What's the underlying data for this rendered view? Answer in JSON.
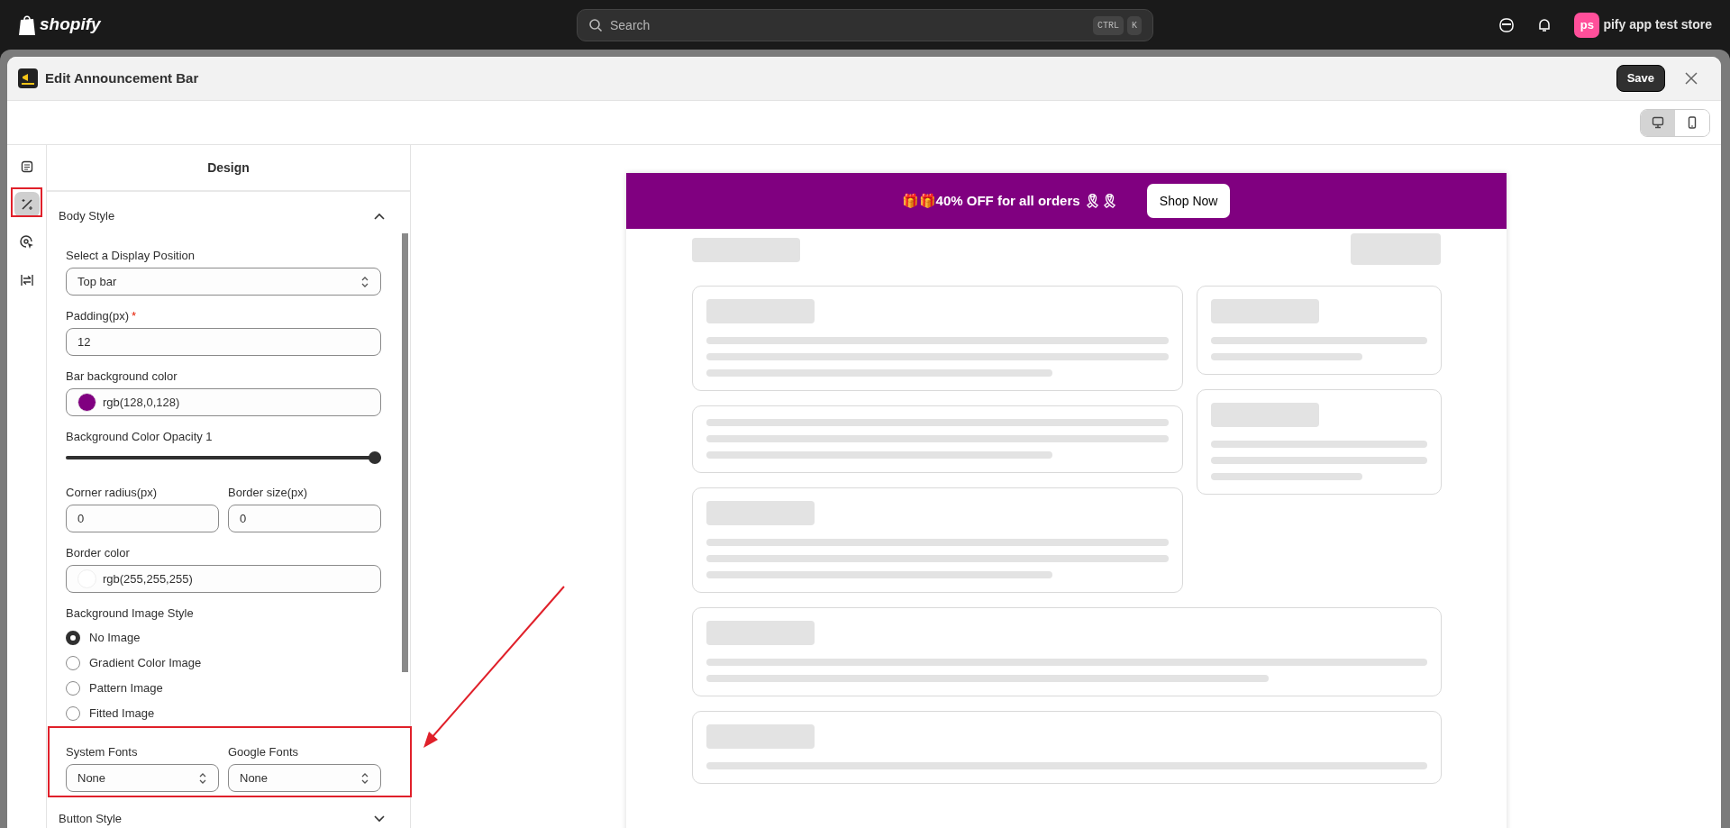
{
  "topbar": {
    "logo_text": "shopify",
    "search": {
      "placeholder": "Search",
      "shortcut": [
        "CTRL",
        "K"
      ]
    },
    "store": {
      "initials": "ps",
      "name": "pify app test store"
    }
  },
  "modal": {
    "title": "Edit Announcement Bar",
    "save": "Save"
  },
  "view_toggle": [
    {
      "kind": "desktop",
      "selected": true
    },
    {
      "kind": "mobile",
      "selected": false
    }
  ],
  "rail": [
    {
      "kind": "list",
      "selected": false
    },
    {
      "kind": "wand",
      "selected": true
    },
    {
      "kind": "target",
      "selected": false
    },
    {
      "kind": "swap",
      "selected": false
    }
  ],
  "panel": {
    "title": "Design",
    "sections": [
      {
        "title": "Body Style",
        "expanded": true
      },
      {
        "title": "Button Style",
        "expanded": false
      }
    ],
    "fields": [
      {
        "kind": "select",
        "label": "Select a Display Position",
        "value": "Top bar"
      },
      {
        "kind": "text",
        "label": "Padding(px)",
        "required_mark": "*",
        "value": "12"
      },
      {
        "kind": "color",
        "label": "Bar background color",
        "value": "rgb(128,0,128)",
        "color": "#800080"
      },
      {
        "kind": "slider",
        "label": "Background Color Opacity 1",
        "level": 1
      },
      {
        "kind": "pair",
        "items": [
          {
            "kind": "text",
            "label": "Corner radius(px)",
            "value": "0"
          },
          {
            "kind": "text",
            "label": "Border size(px)",
            "value": "0"
          }
        ]
      },
      {
        "kind": "color",
        "label": "Border color",
        "value": "rgb(255,255,255)",
        "color": "#ffffff"
      },
      {
        "kind": "radio",
        "label": "Background Image Style",
        "options": [
          {
            "label": "No Image",
            "selected": true
          },
          {
            "label": "Gradient Color Image",
            "selected": false
          },
          {
            "label": "Pattern Image",
            "selected": false
          },
          {
            "label": "Fitted Image",
            "selected": false
          }
        ]
      },
      {
        "kind": "pair",
        "items": [
          {
            "kind": "select",
            "label": "System Fonts",
            "value": "None"
          },
          {
            "kind": "select",
            "label": "Google Fonts",
            "value": "None"
          }
        ]
      }
    ]
  },
  "preview": {
    "announcement": {
      "text": "🎁🎁40% OFF for all orders 🎗🎗",
      "button": "Shop Now",
      "color": "#800080"
    }
  }
}
